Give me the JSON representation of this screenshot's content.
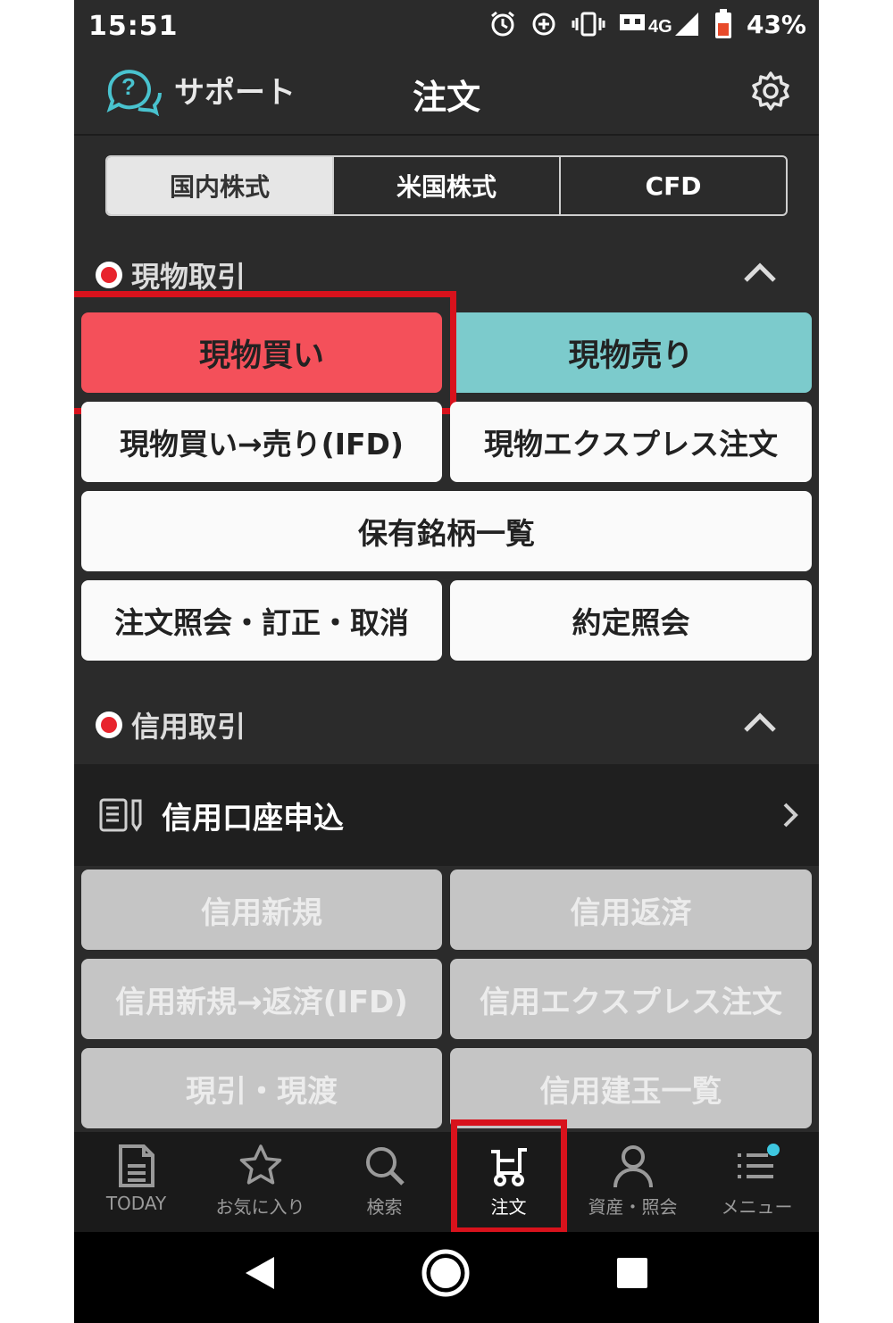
{
  "status": {
    "time": "15:51",
    "network": "4G",
    "battery": "43%"
  },
  "header": {
    "support_label": "サポート",
    "title": "注文"
  },
  "segments": [
    "国内株式",
    "米国株式",
    "CFD"
  ],
  "spot": {
    "section_label": "現物取引",
    "buy": "現物買い",
    "sell": "現物売り",
    "ifd": "現物買い→売り(IFD)",
    "express": "現物エクスプレス注文",
    "holdings": "保有銘柄一覧",
    "order_inquiry": "注文照会・訂正・取消",
    "execution_inquiry": "約定照会"
  },
  "margin": {
    "section_label": "信用取引",
    "apply_label": "信用口座申込",
    "new": "信用新規",
    "repay": "信用返済",
    "ifd": "信用新規→返済(IFD)",
    "express": "信用エクスプレス注文",
    "delivery": "現引・現渡",
    "positions": "信用建玉一覧"
  },
  "tabs": [
    "TODAY",
    "お気に入り",
    "検索",
    "注文",
    "資産・照会",
    "メニュー"
  ],
  "active_tab": "注文",
  "colors": {
    "buy": "#f4505a",
    "sell": "#7ccbcc",
    "highlight": "#d8121c",
    "badge": "#3ec7e0"
  }
}
